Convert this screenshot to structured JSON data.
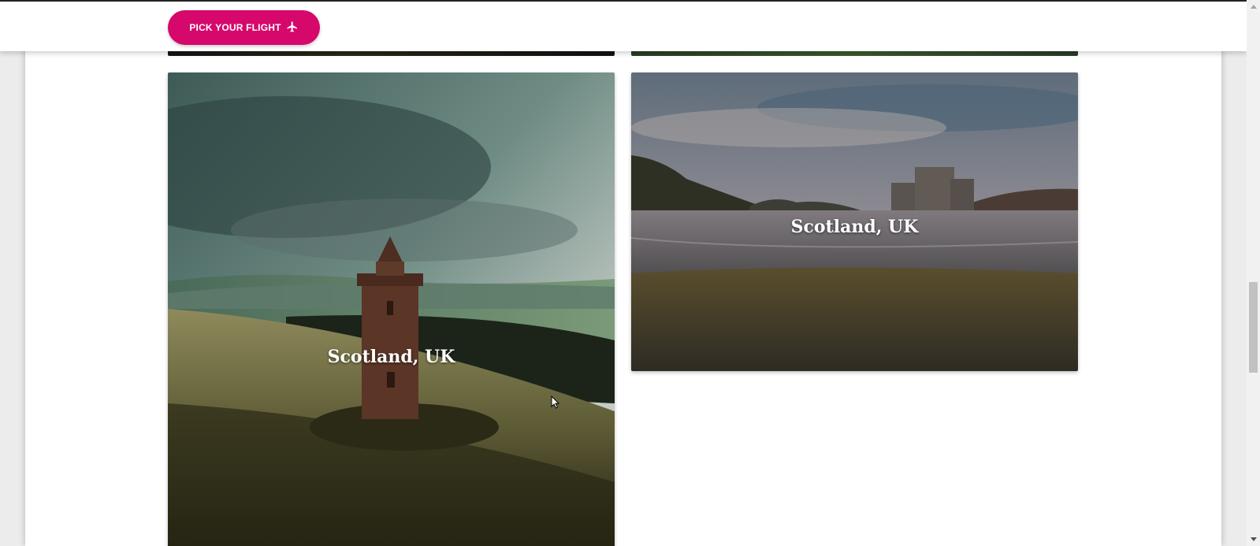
{
  "header": {
    "cta_label": "PICK YOUR FLIGHT",
    "cta_icon": "airplane-icon",
    "brand_color": "#d6086b"
  },
  "gallery": {
    "cards": [
      {
        "caption": "Scotland, UK",
        "scene": "tower on hillside under stormy sky"
      },
      {
        "caption": "Scotland, UK",
        "scene": "castle by a loch at dusk"
      }
    ]
  },
  "scrollbar": {
    "up_icon": "chevron-up-icon",
    "down_icon": "chevron-down-icon"
  }
}
